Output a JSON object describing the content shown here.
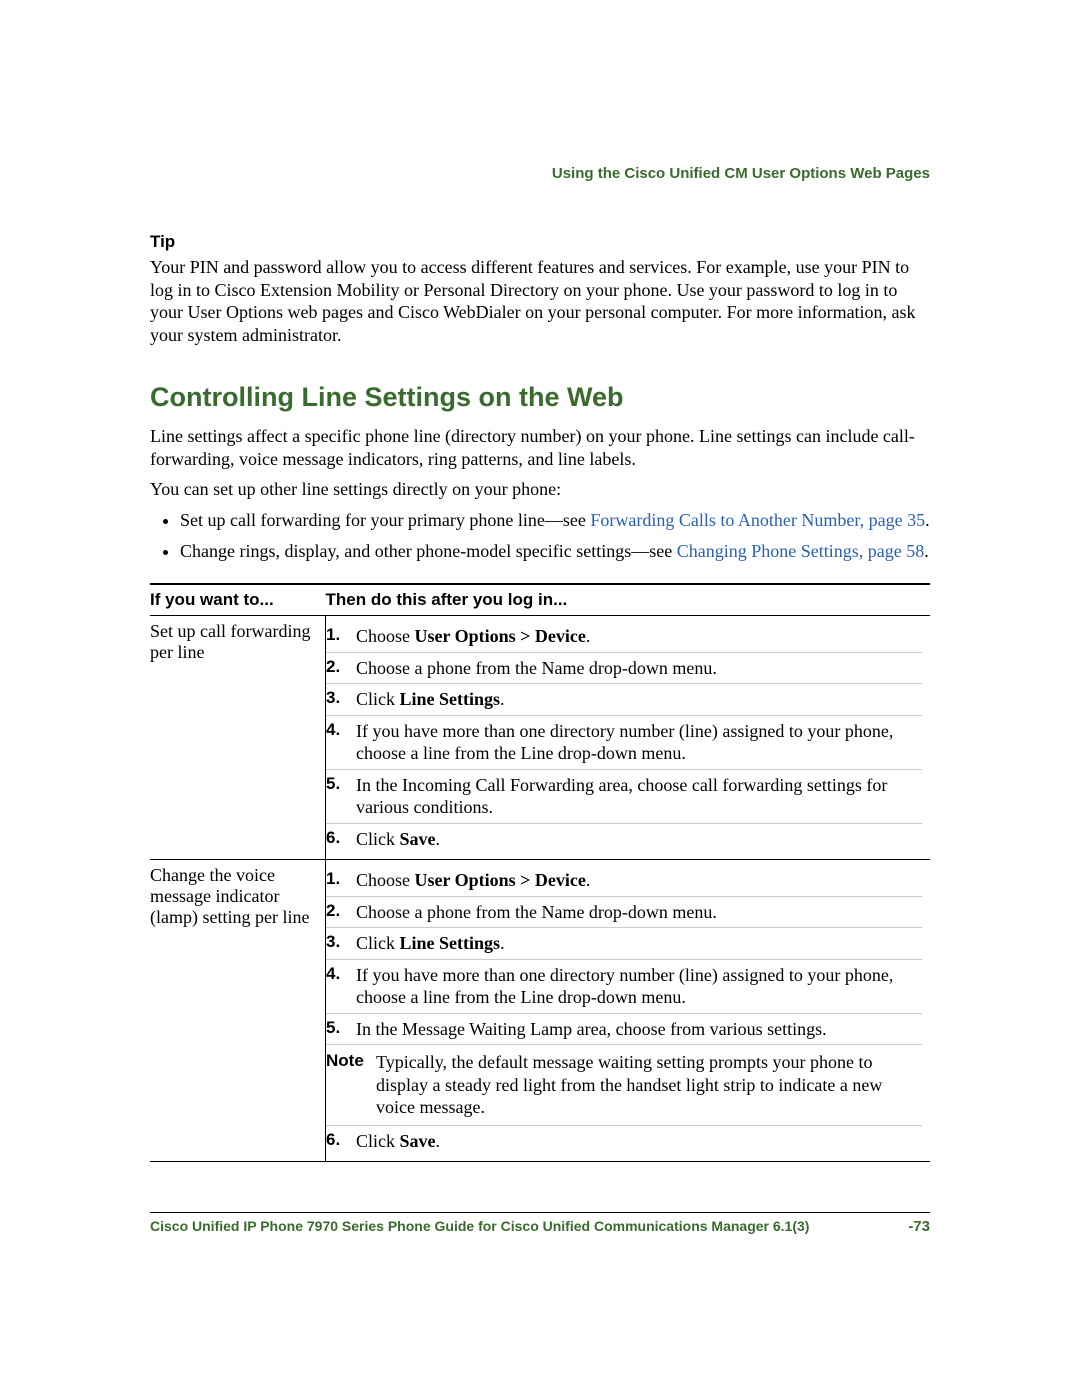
{
  "header": "Using the Cisco Unified CM User Options Web Pages",
  "tip": {
    "label": "Tip",
    "body": "Your PIN and password allow you to access different features and services. For example, use your PIN to log in to Cisco Extension Mobility or Personal Directory on your phone. Use your password to log in to your User Options web pages and Cisco WebDialer on your personal computer. For more information, ask your system administrator."
  },
  "section_title": "Controlling Line Settings on the Web",
  "intro1": "Line settings affect a specific phone line (directory number) on your phone. Line settings can include call-forwarding, voice message indicators, ring patterns, and line labels.",
  "intro2": "You can set up other line settings directly on your phone:",
  "bullets": [
    {
      "pre": "Set up call forwarding for your primary phone line—see ",
      "link": "Forwarding Calls to Another Number, page 35",
      "post": "."
    },
    {
      "pre": "Change rings, display, and other phone-model specific settings—see ",
      "link": "Changing Phone Settings, page 58",
      "post": "."
    }
  ],
  "table": {
    "col1": "If you want to...",
    "col2": "Then do this after you log in...",
    "rows": [
      {
        "want": "Set up call forwarding per line",
        "steps": [
          {
            "n": "1.",
            "pre": "Choose ",
            "b": "User Options > Device",
            "post": "."
          },
          {
            "n": "2.",
            "pre": "Choose a phone from the Name drop-down menu.",
            "b": "",
            "post": ""
          },
          {
            "n": "3.",
            "pre": "Click ",
            "b": "Line Settings",
            "post": "."
          },
          {
            "n": "4.",
            "pre": "If you have more than one directory number (line) assigned to your phone, choose a line from the Line drop-down menu.",
            "b": "",
            "post": ""
          },
          {
            "n": "5.",
            "pre": "In the Incoming Call Forwarding area, choose call forwarding settings for various conditions.",
            "b": "",
            "post": ""
          },
          {
            "n": "6.",
            "pre": "Click ",
            "b": "Save",
            "post": "."
          }
        ]
      },
      {
        "want": "Change the voice message indicator (lamp) setting per line",
        "steps": [
          {
            "n": "1.",
            "pre": "Choose ",
            "b": "User Options > Device",
            "post": "."
          },
          {
            "n": "2.",
            "pre": "Choose a phone from the Name drop-down menu.",
            "b": "",
            "post": ""
          },
          {
            "n": "3.",
            "pre": "Click ",
            "b": "Line Settings",
            "post": "."
          },
          {
            "n": "4.",
            "pre": "If you have more than one directory number (line) assigned to your phone, choose a line from the Line drop-down menu.",
            "b": "",
            "post": ""
          },
          {
            "n": "5.",
            "pre": "In the Message Waiting Lamp area, choose from various settings.",
            "b": "",
            "post": ""
          }
        ],
        "note": {
          "label": "Note",
          "text": "Typically, the default message waiting setting prompts your phone to display a steady red light from the handset light strip to indicate a new voice message."
        },
        "steps_after": [
          {
            "n": "6.",
            "pre": "Click ",
            "b": "Save",
            "post": "."
          }
        ]
      }
    ]
  },
  "footer": {
    "left": "Cisco Unified IP Phone 7970 Series Phone Guide for Cisco Unified Communications Manager 6.1(3)",
    "right": "-73"
  }
}
